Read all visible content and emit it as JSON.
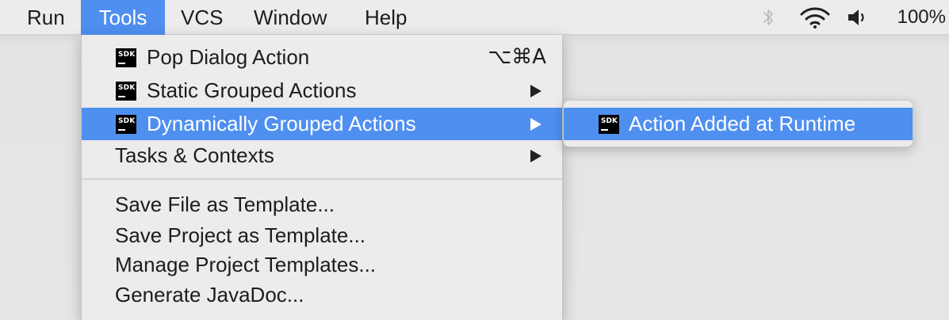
{
  "menubar": {
    "items": [
      {
        "label": "Run"
      },
      {
        "label": "Tools",
        "active": true
      },
      {
        "label": "VCS"
      },
      {
        "label": "Window"
      },
      {
        "label": "Help"
      }
    ],
    "status": {
      "icons": [
        "bluetooth-icon",
        "wifi-icon",
        "volume-icon"
      ],
      "battery": "100%"
    }
  },
  "tools_menu": {
    "items": [
      {
        "label": "Pop Dialog Action",
        "icon": "SDK",
        "shortcut": "⌥⌘A"
      },
      {
        "label": "Static Grouped Actions",
        "icon": "SDK",
        "submenu": true
      },
      {
        "label": "Dynamically Grouped Actions",
        "icon": "SDK",
        "submenu": true,
        "highlighted": true
      },
      {
        "label": "Tasks & Contexts",
        "submenu": true
      },
      {
        "label": "Save File as Template..."
      },
      {
        "label": "Save Project as Template..."
      },
      {
        "label": "Manage Project Templates..."
      },
      {
        "label": "Generate JavaDoc..."
      }
    ]
  },
  "submenu": {
    "items": [
      {
        "label": "Action Added at Runtime",
        "icon": "SDK",
        "highlighted": true
      }
    ]
  },
  "colors": {
    "highlight": "#4f8ff0",
    "menu_bg": "#ececec"
  }
}
